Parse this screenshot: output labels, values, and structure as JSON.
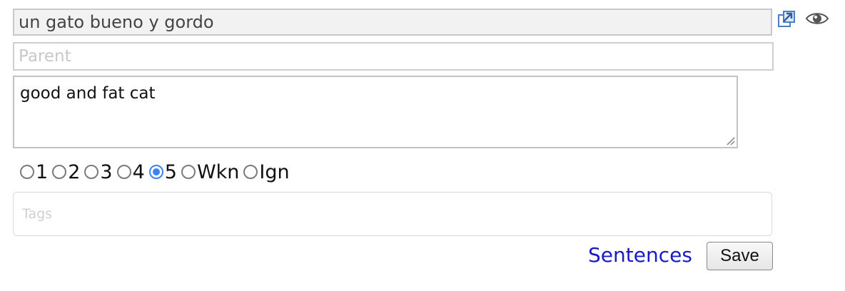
{
  "term": {
    "value": "un gato bueno y gordo"
  },
  "parent": {
    "placeholder": "Parent",
    "value": ""
  },
  "translation": {
    "value": "good and fat cat"
  },
  "icons": {
    "link": "external-link-icon",
    "eye": "eye-icon"
  },
  "status": {
    "options": [
      "1",
      "2",
      "3",
      "4",
      "5",
      "Wkn",
      "Ign"
    ],
    "selected": "5",
    "accent_color": "#3b82f6"
  },
  "tags": {
    "placeholder": "Tags",
    "value": ""
  },
  "actions": {
    "sentences_label": "Sentences",
    "save_label": "Save",
    "link_color": "#1a1ac8"
  }
}
